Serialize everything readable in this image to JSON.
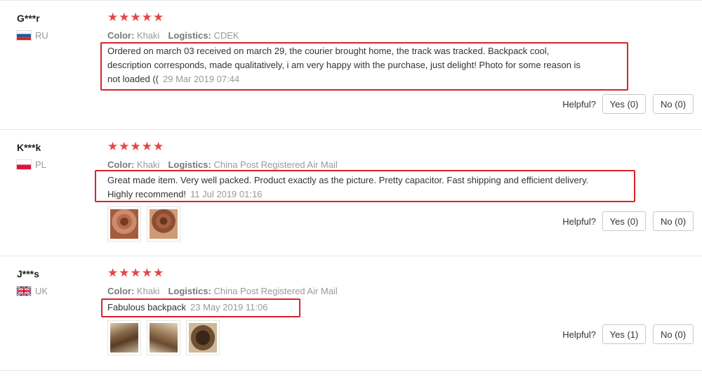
{
  "reviews": [
    {
      "user": "G***r",
      "country": "RU",
      "flag_icon": "russia-flag-icon",
      "stars": "★★★★★",
      "color_label": "Color:",
      "color_value": "Khaki",
      "logistics_label": "Logistics:",
      "logistics_value": "CDEK",
      "text_line1": "Ordered on march 03 received on march 29, the courier brought home, the track was tracked. Backpack cool,",
      "text_line2": "description corresponds, made qualitatively, i am very happy with the purchase, just delight! Photo for some reason is",
      "text_line3": "not loaded ((",
      "date": "29 Mar 2019 07:44",
      "helpful_label": "Helpful?",
      "yes_label": "Yes (0)",
      "no_label": "No (0)"
    },
    {
      "user": "K***k",
      "country": "PL",
      "flag_icon": "poland-flag-icon",
      "stars": "★★★★★",
      "color_label": "Color:",
      "color_value": "Khaki",
      "logistics_label": "Logistics:",
      "logistics_value": "China Post Registered Air Mail",
      "text_line1": "Great made item. Very well packed. Product exactly as the picture. Pretty capacitor. Fast shipping and efficient delivery.",
      "text_line2": "Highly recommend!",
      "date": "11 Jul 2019 01:16",
      "helpful_label": "Helpful?",
      "yes_label": "Yes (0)",
      "no_label": "No (0)"
    },
    {
      "user": "J***s",
      "country": "UK",
      "flag_icon": "uk-flag-icon",
      "stars": "★★★★★",
      "color_label": "Color:",
      "color_value": "Khaki",
      "logistics_label": "Logistics:",
      "logistics_value": "China Post Registered Air Mail",
      "text_line1": "Fabulous backpack",
      "date": "23 May 2019 11:06",
      "helpful_label": "Helpful?",
      "yes_label": "Yes (1)",
      "no_label": "No (0)"
    }
  ],
  "colors": {
    "star": "#e64545",
    "highlight_border": "#d9232b",
    "muted_text": "#999999"
  }
}
